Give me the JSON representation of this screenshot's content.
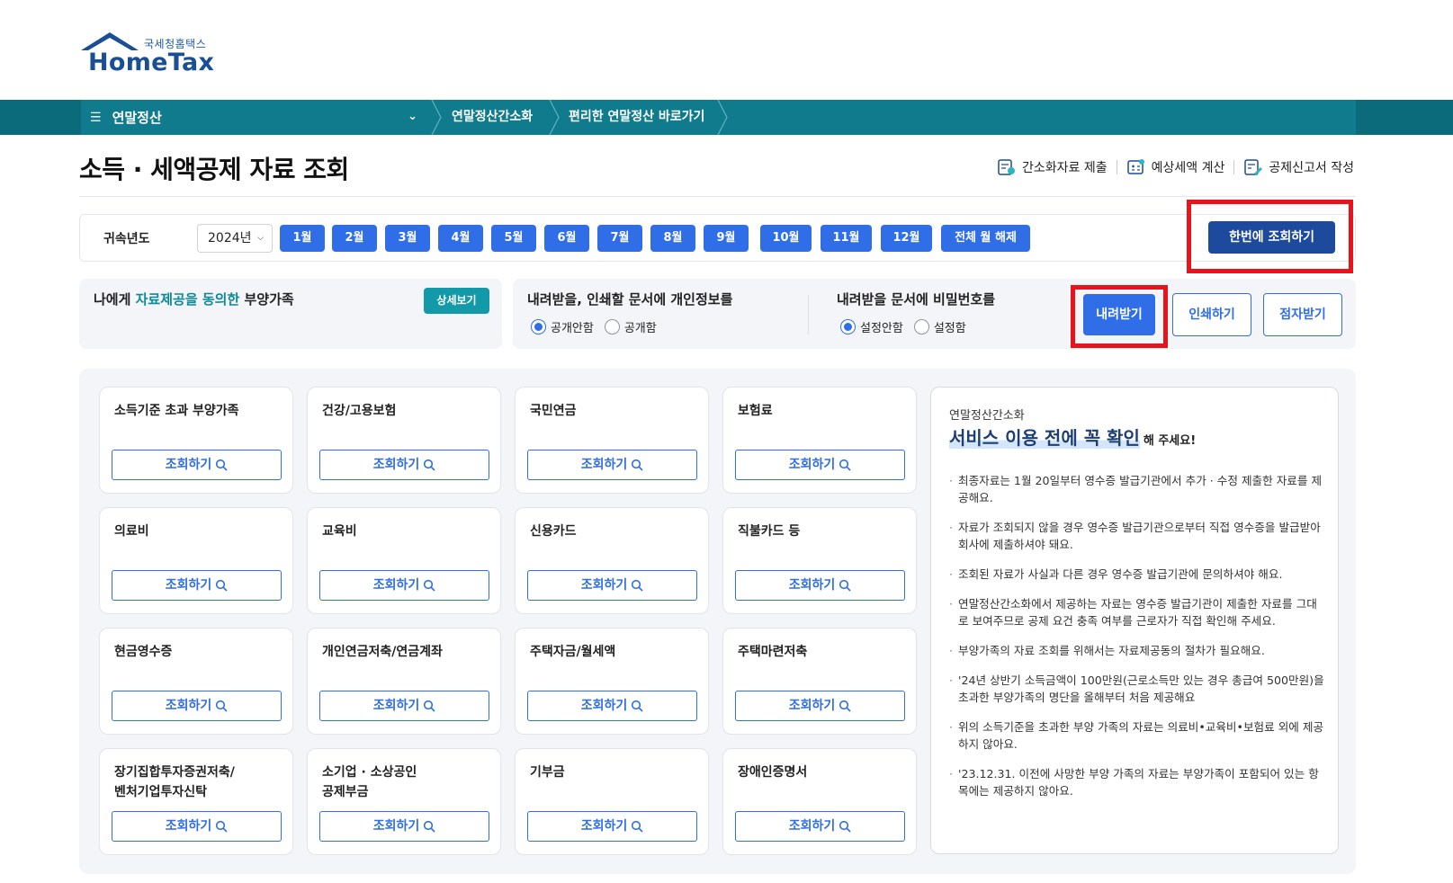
{
  "brand": {
    "sub": "국세청홈택스",
    "name": "HomeTax"
  },
  "nav": {
    "menu_label": "연말정산",
    "items": [
      "연말정산간소화",
      "편리한 연말정산 바로가기"
    ]
  },
  "page_title": "소득 · 세액공제 자료 조회",
  "quick_links": [
    "간소화자료 제출",
    "예상세액 계산",
    "공제신고서 작성"
  ],
  "year_bar": {
    "label": "귀속년도",
    "selected_year": "2024년",
    "months": [
      "1월",
      "2월",
      "3월",
      "4월",
      "5월",
      "6월",
      "7월",
      "8월",
      "9월",
      "10월",
      "11월",
      "12월"
    ],
    "clear_all": "전체 월 해제",
    "query_all": "한번에 조회하기"
  },
  "dependents": {
    "prefix": "나에게 ",
    "highlight": "자료제공을 동의한",
    "suffix": " 부양가족",
    "detail_btn": "상세보기"
  },
  "privacy": {
    "title": "내려받을, 인쇄할 문서에 개인정보를",
    "options": [
      "공개안함",
      "공개함"
    ],
    "selected": 0
  },
  "password": {
    "title": "내려받을 문서에 비밀번호를",
    "options": [
      "설정안함",
      "설정함"
    ],
    "selected": 0
  },
  "actions": {
    "download": "내려받기",
    "print": "인쇄하기",
    "braille": "점자받기"
  },
  "cards": [
    {
      "title": "소득기준 초과 부양가족",
      "btn": "조회하기"
    },
    {
      "title": "건강/고용보험",
      "btn": "조회하기"
    },
    {
      "title": "국민연금",
      "btn": "조회하기"
    },
    {
      "title": "보험료",
      "btn": "조회하기"
    },
    {
      "title": "의료비",
      "btn": "조회하기"
    },
    {
      "title": "교육비",
      "btn": "조회하기"
    },
    {
      "title": "신용카드",
      "btn": "조회하기"
    },
    {
      "title": "직불카드 등",
      "btn": "조회하기"
    },
    {
      "title": "현금영수증",
      "btn": "조회하기"
    },
    {
      "title": "개인연금저축/연금계좌",
      "btn": "조회하기"
    },
    {
      "title": "주택자금/월세액",
      "btn": "조회하기"
    },
    {
      "title": "주택마련저축",
      "btn": "조회하기"
    },
    {
      "title": "장기집합투자증권저축/\n벤처기업투자신탁",
      "btn": "조회하기"
    },
    {
      "title": "소기업 · 소상공인\n공제부금",
      "btn": "조회하기"
    },
    {
      "title": "기부금",
      "btn": "조회하기"
    },
    {
      "title": "장애인증명서",
      "btn": "조회하기"
    }
  ],
  "notice": {
    "sub": "연말정산간소화",
    "head": "서비스 이용 전에 꼭 확인",
    "head_small": "해 주세요!",
    "items": [
      "최종자료는 1월 20일부터 영수증 발급기관에서 추가 · 수정 제출한 자료를 제공해요.",
      "자료가 조회되지 않을 경우 영수증 발급기관으로부터 직접 영수증을 발급받아 회사에 제출하셔야 돼요.",
      "조회된 자료가 사실과 다른 경우 영수증 발급기관에 문의하셔야 해요.",
      "연말정산간소화에서 제공하는 자료는 영수증 발급기관이 제출한 자료를 그대로 보여주므로 공제 요건 충족 여부를 근로자가 직접 확인해 주세요.",
      "부양가족의 자료 조회를 위해서는 자료제공동의 절차가 필요해요.",
      "'24년 상반기 소득금액이 100만원(근로소득만 있는 경우 총급여 500만원)을 초과한 부양가족의 명단을 올해부터 처음 제공해요",
      "위의 소득기준을 초과한 부양 가족의 자료는 의료비•교육비•보험료 외에 제공하지 않아요.",
      "'23.12.31. 이전에 사망한 부양 가족의 자료는 부양가족이 포함되어 있는 항목에는 제공하지 않아요."
    ]
  },
  "colors": {
    "nav_teal": "#0f7b8c",
    "primary_blue": "#2f6ee6",
    "dark_blue": "#1d4a9c",
    "highlight_red": "#e8141b"
  }
}
